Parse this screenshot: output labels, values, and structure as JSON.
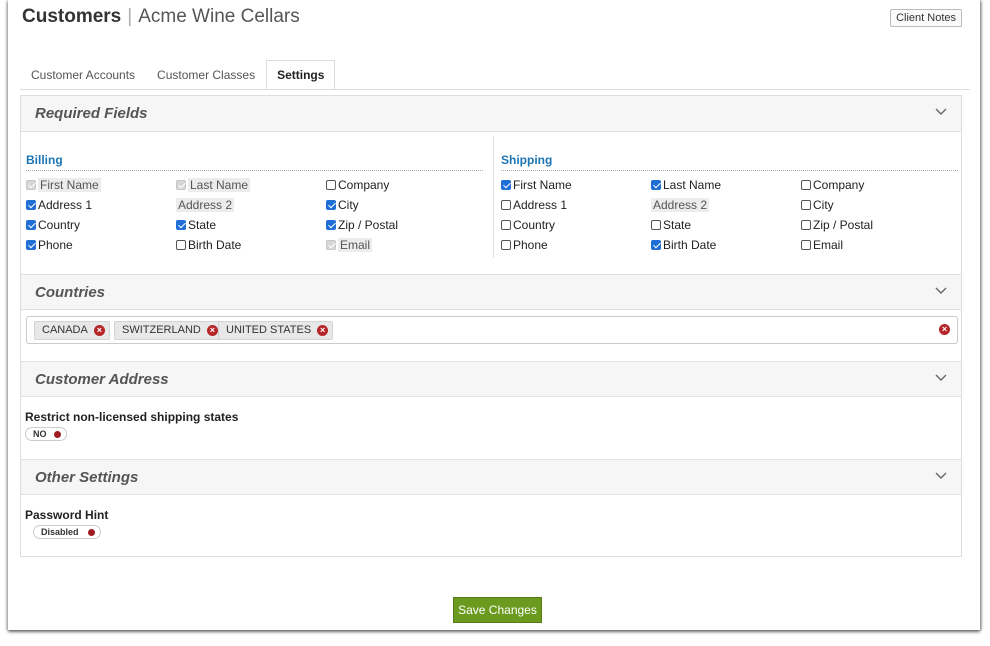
{
  "header": {
    "title": "Customers",
    "subtitle": "Acme Wine Cellars",
    "client_notes_label": "Client Notes"
  },
  "tabs": [
    {
      "label": "Customer Accounts",
      "active": false
    },
    {
      "label": "Customer Classes",
      "active": false
    },
    {
      "label": "Settings",
      "active": true
    }
  ],
  "required_fields": {
    "title": "Required Fields",
    "billing": {
      "title": "Billing",
      "fields": [
        {
          "label": "First Name",
          "state": "disabled"
        },
        {
          "label": "Last Name",
          "state": "disabled"
        },
        {
          "label": "Company",
          "state": "unchecked"
        },
        {
          "label": "Address 1",
          "state": "checked"
        },
        {
          "label": "Address 2",
          "state": "unchecked-disabled"
        },
        {
          "label": "City",
          "state": "checked"
        },
        {
          "label": "Country",
          "state": "checked"
        },
        {
          "label": "State",
          "state": "checked"
        },
        {
          "label": "Zip / Postal",
          "state": "checked"
        },
        {
          "label": "Phone",
          "state": "checked"
        },
        {
          "label": "Birth Date",
          "state": "unchecked"
        },
        {
          "label": "Email",
          "state": "disabled"
        }
      ]
    },
    "shipping": {
      "title": "Shipping",
      "fields": [
        {
          "label": "First Name",
          "state": "checked"
        },
        {
          "label": "Last Name",
          "state": "checked"
        },
        {
          "label": "Company",
          "state": "unchecked"
        },
        {
          "label": "Address 1",
          "state": "unchecked"
        },
        {
          "label": "Address 2",
          "state": "unchecked-disabled"
        },
        {
          "label": "City",
          "state": "unchecked"
        },
        {
          "label": "Country",
          "state": "unchecked"
        },
        {
          "label": "State",
          "state": "unchecked"
        },
        {
          "label": "Zip / Postal",
          "state": "unchecked"
        },
        {
          "label": "Phone",
          "state": "unchecked"
        },
        {
          "label": "Birth Date",
          "state": "checked"
        },
        {
          "label": "Email",
          "state": "unchecked"
        }
      ]
    }
  },
  "countries": {
    "title": "Countries",
    "selected": [
      "CANADA",
      "SWITZERLAND",
      "UNITED STATES"
    ]
  },
  "customer_address": {
    "title": "Customer Address",
    "restrict_label": "Restrict non-licensed shipping states",
    "restrict_value": "NO"
  },
  "other_settings": {
    "title": "Other Settings",
    "password_hint_label": "Password Hint",
    "password_hint_value": "Disabled"
  },
  "footer": {
    "save_label": "Save Changes"
  },
  "colors": {
    "accent_blue": "#1d75b3",
    "checkbox_blue": "#1f6fd6",
    "save_green": "#6b9b1e",
    "remove_red": "#b5262a"
  }
}
